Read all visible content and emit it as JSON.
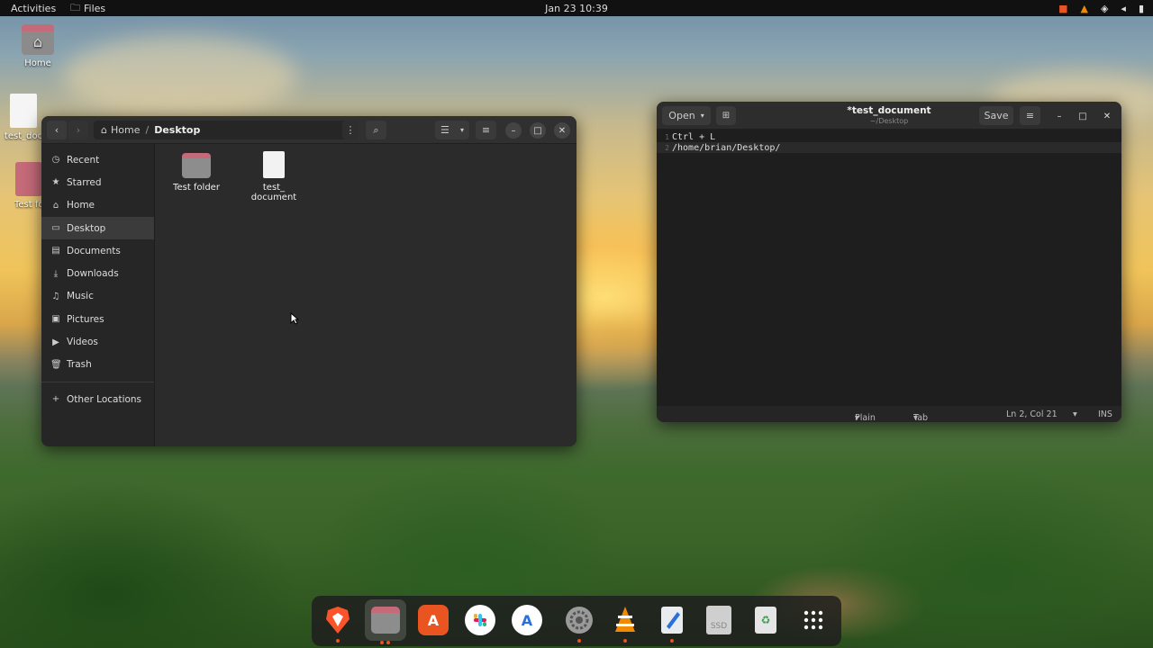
{
  "topbar": {
    "activities": "Activities",
    "app_name": "Files",
    "clock": "Jan 23  10:39"
  },
  "desktop": {
    "icons": [
      {
        "label": "Home"
      },
      {
        "label": "test_doc"
      },
      {
        "label": "Test fo"
      }
    ]
  },
  "files_window": {
    "breadcrumb_home": "Home",
    "breadcrumb_current": "Desktop",
    "sidebar": {
      "items": [
        {
          "label": "Recent",
          "icon": "clock-icon"
        },
        {
          "label": "Starred",
          "icon": "star-icon"
        },
        {
          "label": "Home",
          "icon": "home-icon"
        },
        {
          "label": "Desktop",
          "icon": "desktop-icon"
        },
        {
          "label": "Documents",
          "icon": "document-icon"
        },
        {
          "label": "Downloads",
          "icon": "download-icon"
        },
        {
          "label": "Music",
          "icon": "music-icon"
        },
        {
          "label": "Pictures",
          "icon": "picture-icon"
        },
        {
          "label": "Videos",
          "icon": "video-icon"
        },
        {
          "label": "Trash",
          "icon": "trash-icon"
        }
      ],
      "other_locations": "Other Locations"
    },
    "files": [
      {
        "name": "Test folder",
        "type": "folder"
      },
      {
        "name_line1": "test_",
        "name_line2": "document",
        "type": "text"
      }
    ]
  },
  "editor_window": {
    "open_label": "Open",
    "title": "*test_document",
    "subtitle": "~/Desktop",
    "save_label": "Save",
    "lines": [
      {
        "num": "1",
        "text": "Ctrl + L"
      },
      {
        "num": "2",
        "text": "/home/brian/Desktop/"
      }
    ],
    "status": {
      "language": "Plain Text",
      "tab_width": "Tab Width: 8",
      "position": "Ln 2, Col 21",
      "mode": "INS"
    }
  },
  "dock": {
    "items": [
      "brave-icon",
      "files-icon",
      "app-center-icon",
      "slack-icon",
      "app-icon",
      "settings-icon",
      "vlc-icon",
      "text-editor-icon",
      "ssd-drive-icon",
      "trash-bin-icon",
      "app-grid-icon"
    ],
    "ssd_label": "SSD"
  },
  "colors": {
    "accent": "#e95420",
    "brave": "#fb542b",
    "vlc": "#f18a00",
    "app_center": "#e95420"
  }
}
